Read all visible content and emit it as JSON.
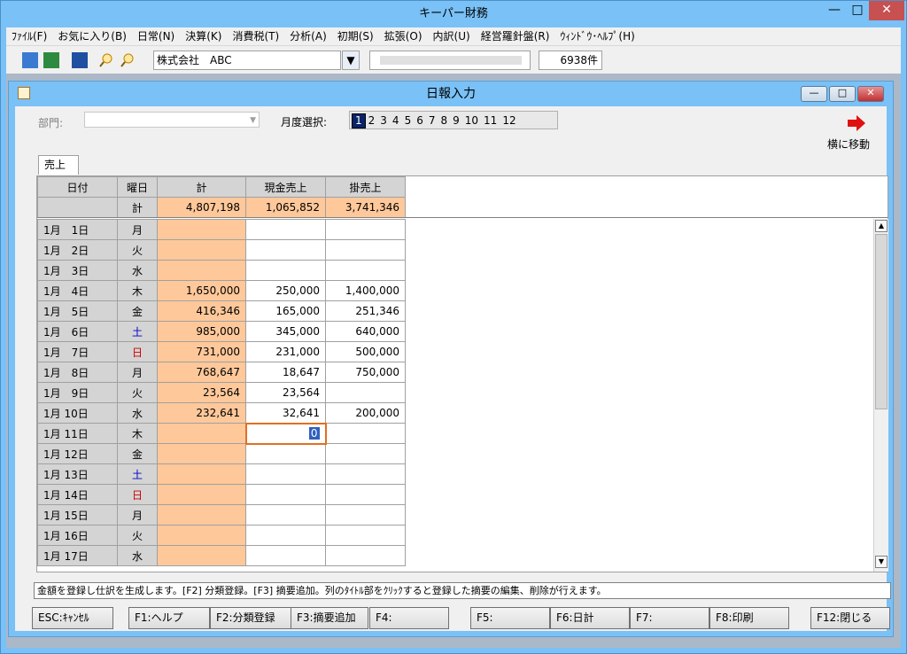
{
  "app": {
    "title": "キーパー財務"
  },
  "menu": [
    "ﾌｧｲﾙ(F)",
    "お気に入り(B)",
    "日常(N)",
    "決算(K)",
    "消費税(T)",
    "分析(A)",
    "初期(S)",
    "拡張(O)",
    "内訳(U)",
    "経営羅針盤(R)",
    "ｳｨﾝﾄﾞｳ･ﾍﾙﾌﾟ(H)"
  ],
  "toolbar": {
    "company": "株式会社　ABC",
    "count": "6938件"
  },
  "window": {
    "title": "日報入力"
  },
  "filters": {
    "dept_label": "部門:",
    "month_label": "月度選択:",
    "months": [
      "1",
      "2",
      "3",
      "4",
      "5",
      "6",
      "7",
      "8",
      "9",
      "10",
      "11",
      "12"
    ],
    "move_label": "横に移動"
  },
  "tab": "売上",
  "grid": {
    "headers": [
      "日付",
      "曜日",
      "計",
      "現金売上",
      "掛売上"
    ],
    "total": {
      "label": "計",
      "sum": "4,807,198",
      "cash": "1,065,852",
      "credit": "3,741,346"
    },
    "rows": [
      {
        "date": "1月　1日",
        "dow": "月",
        "sum": "",
        "cash": "",
        "credit": "",
        "color": ""
      },
      {
        "date": "1月　2日",
        "dow": "火",
        "sum": "",
        "cash": "",
        "credit": "",
        "color": ""
      },
      {
        "date": "1月　3日",
        "dow": "水",
        "sum": "",
        "cash": "",
        "credit": "",
        "color": ""
      },
      {
        "date": "1月　4日",
        "dow": "木",
        "sum": "1,650,000",
        "cash": "250,000",
        "credit": "1,400,000",
        "color": ""
      },
      {
        "date": "1月　5日",
        "dow": "金",
        "sum": "416,346",
        "cash": "165,000",
        "credit": "251,346",
        "color": ""
      },
      {
        "date": "1月　6日",
        "dow": "土",
        "sum": "985,000",
        "cash": "345,000",
        "credit": "640,000",
        "color": "blue"
      },
      {
        "date": "1月　7日",
        "dow": "日",
        "sum": "731,000",
        "cash": "231,000",
        "credit": "500,000",
        "color": "red"
      },
      {
        "date": "1月　8日",
        "dow": "月",
        "sum": "768,647",
        "cash": "18,647",
        "credit": "750,000",
        "color": ""
      },
      {
        "date": "1月　9日",
        "dow": "火",
        "sum": "23,564",
        "cash": "23,564",
        "credit": "",
        "color": ""
      },
      {
        "date": "1月 10日",
        "dow": "水",
        "sum": "232,641",
        "cash": "32,641",
        "credit": "200,000",
        "color": ""
      },
      {
        "date": "1月 11日",
        "dow": "木",
        "sum": "",
        "cash": "0",
        "credit": "",
        "color": ""
      },
      {
        "date": "1月 12日",
        "dow": "金",
        "sum": "",
        "cash": "",
        "credit": "",
        "color": ""
      },
      {
        "date": "1月 13日",
        "dow": "土",
        "sum": "",
        "cash": "",
        "credit": "",
        "color": "blue"
      },
      {
        "date": "1月 14日",
        "dow": "日",
        "sum": "",
        "cash": "",
        "credit": "",
        "color": "red"
      },
      {
        "date": "1月 15日",
        "dow": "月",
        "sum": "",
        "cash": "",
        "credit": "",
        "color": ""
      },
      {
        "date": "1月 16日",
        "dow": "火",
        "sum": "",
        "cash": "",
        "credit": "",
        "color": ""
      },
      {
        "date": "1月 17日",
        "dow": "水",
        "sum": "",
        "cash": "",
        "credit": "",
        "color": ""
      }
    ]
  },
  "status": "金額を登録し仕訳を生成します。[F2] 分類登録。[F3] 摘要追加。列のﾀｲﾄﾙ部をｸﾘｯｸすると登録した摘要の編集、削除が行えます。",
  "fkeys": [
    "ESC:ｷｬﾝｾﾙ",
    "F1:ヘルプ",
    "F2:分類登録",
    "F3:摘要追加",
    "F4:",
    "F5:",
    "F6:日計",
    "F7:",
    "F8:印刷",
    "F12:閉じる"
  ]
}
